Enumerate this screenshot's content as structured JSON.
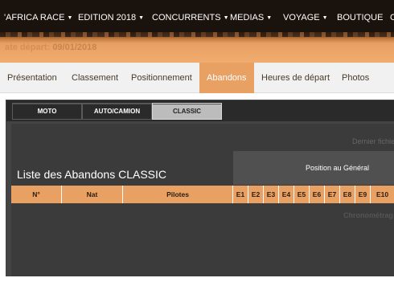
{
  "topnav": {
    "items": [
      {
        "label": "'AFRICA RACE",
        "dropdown": true
      },
      {
        "label": "EDITION 2018",
        "dropdown": true
      },
      {
        "label": "CONCURRENTS",
        "dropdown": true
      },
      {
        "label": "MEDIAS",
        "dropdown": true
      },
      {
        "label": "VOYAGE",
        "dropdown": true
      },
      {
        "label": "BOUTIQUE",
        "dropdown": false
      },
      {
        "label": "C",
        "dropdown": false
      }
    ],
    "caret": "▼"
  },
  "banner": {
    "date_label": "ate départ:",
    "date_value": "09/01/2018"
  },
  "tabs": {
    "items": [
      "Présentation",
      "Classement",
      "Positionnement",
      "Abandons",
      "Heures de départ",
      "Photos"
    ],
    "active": "Abandons"
  },
  "subtabs": {
    "items": [
      "MOTO",
      "AUTO/CAMION",
      "CLASSIC"
    ],
    "active": "CLASSIC"
  },
  "panel": {
    "last_file": "Dernier fichier",
    "title": "Liste des Abandons CLASSIC",
    "position_header": "Position au Général",
    "columns": [
      "N°",
      "Nat",
      "Pilotes"
    ],
    "stages": [
      "E1",
      "E2",
      "E3",
      "E4",
      "E5",
      "E6",
      "E7",
      "E8",
      "E9",
      "E10"
    ],
    "chrono": "Chronométrag"
  },
  "colors": {
    "accent": "#e8a063",
    "nav_bg": "#1a120d",
    "panel_bg": "#3b3b3b"
  }
}
